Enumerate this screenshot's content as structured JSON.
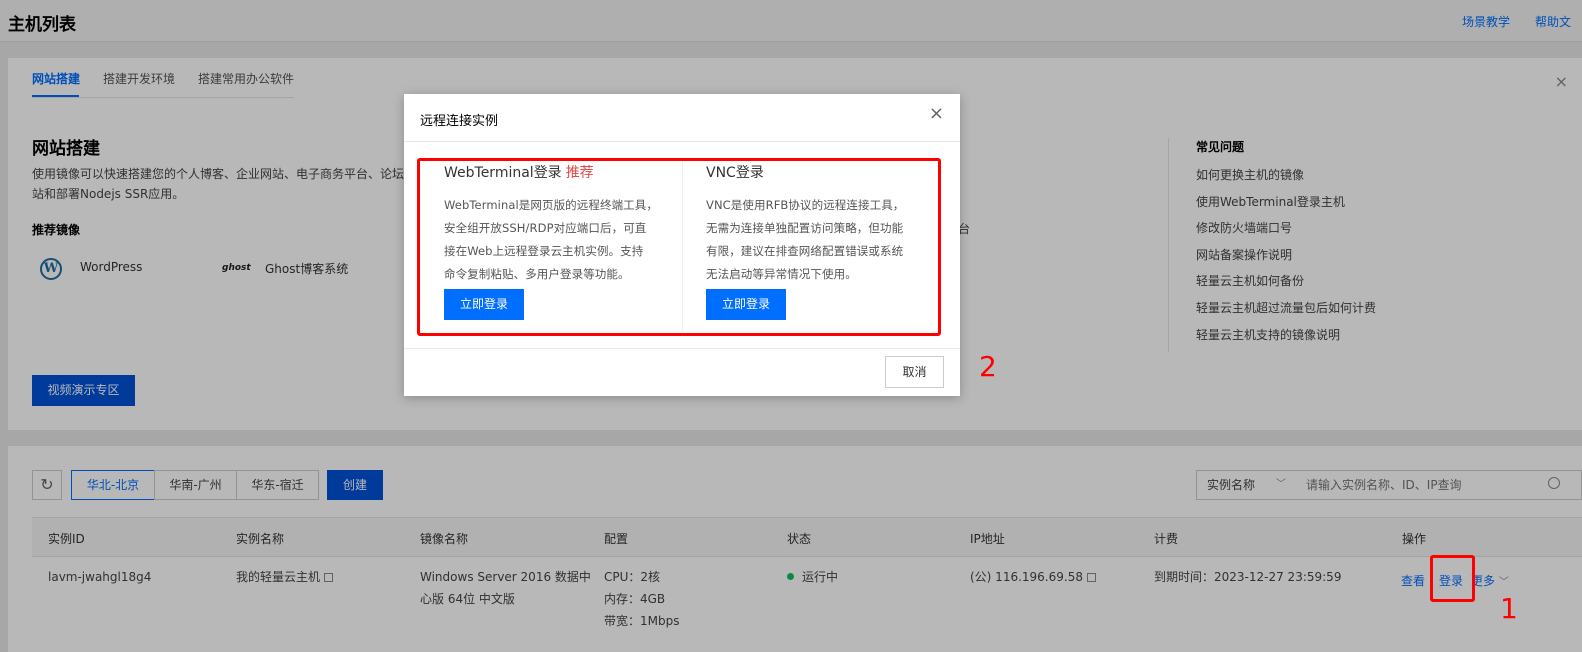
{
  "header": {
    "title": "主机列表",
    "links": [
      "场景教学",
      "帮助文"
    ]
  },
  "guide": {
    "tabs": [
      "网站搭建",
      "搭建开发环境",
      "搭建常用办公软件"
    ],
    "heading": "网站搭建",
    "desc_line1": "使用镜像可以快速搭建您的个人博客、企业网站、电子商务平台、论坛",
    "desc_line2": "站和部署Nodejs SSR应用。",
    "recommended_label": "推荐镜像",
    "mirrors": [
      "WordPress",
      "Ghost博客系统"
    ],
    "ghost_logo": "ghost",
    "wordpress_logo": "W",
    "fragment": "台",
    "video_button": "视频演示专区",
    "faq_title": "常见问题",
    "faq_items": [
      "如何更换主机的镜像",
      "使用WebTerminal登录主机",
      "修改防火墙端口号",
      "网站备案操作说明",
      "轻量云主机如何备份",
      "轻量云主机超过流量包后如何计费",
      "轻量云主机支持的镜像说明"
    ],
    "close_glyph": "×"
  },
  "toolbar": {
    "refresh_glyph": "↻",
    "regions": [
      "华北-北京",
      "华南-广州",
      "华东-宿迁"
    ],
    "create_button": "创建",
    "filter_select": "实例名称",
    "search_placeholder": "请输入实例名称、ID、IP查询"
  },
  "table": {
    "columns": [
      "实例ID",
      "实例名称",
      "镜像名称",
      "配置",
      "状态",
      "IP地址",
      "计费",
      "操作"
    ],
    "row": {
      "id": "lavm-jwahgl18g4",
      "name": "我的轻量云主机",
      "image_line1": "Windows Server 2016 数据中",
      "image_line2": "心版 64位 中文版",
      "cpu": "CPU：2核",
      "memory": "内存：4GB",
      "bandwidth": "带宽：1Mbps",
      "status": "运行中",
      "ip": "(公) 116.196.69.58",
      "billing": "到期时间：2023-12-27 23:59:59",
      "ops": [
        "查看",
        "登录",
        "更多"
      ]
    }
  },
  "modal": {
    "title": "远程连接实例",
    "close_glyph": "×",
    "options": [
      {
        "title": "WebTerminal登录",
        "tag": "推荐",
        "desc": [
          "WebTerminal是网页版的远程终端工具，",
          "安全组开放SSH/RDP对应端口后，可直",
          "接在Web上远程登录云主机实例。支持",
          "命令复制粘贴、多用户登录等功能。"
        ],
        "button": "立即登录"
      },
      {
        "title": "VNC登录",
        "tag": "",
        "desc": [
          "VNC是使用RFB协议的远程连接工具，",
          "无需为连接单独配置访问策略，但功能",
          "有限，建议在排查网络配置错误或系统",
          "无法启动等异常情况下使用。"
        ],
        "button": "立即登录"
      }
    ],
    "cancel_button": "取消"
  },
  "annotations": {
    "step1": "1",
    "step2": "2",
    "color": "#ff0000"
  },
  "colors": {
    "primary": "#006eff",
    "primary_dark": "#0052d9",
    "danger": "#e54545",
    "success": "#0abf5b"
  }
}
